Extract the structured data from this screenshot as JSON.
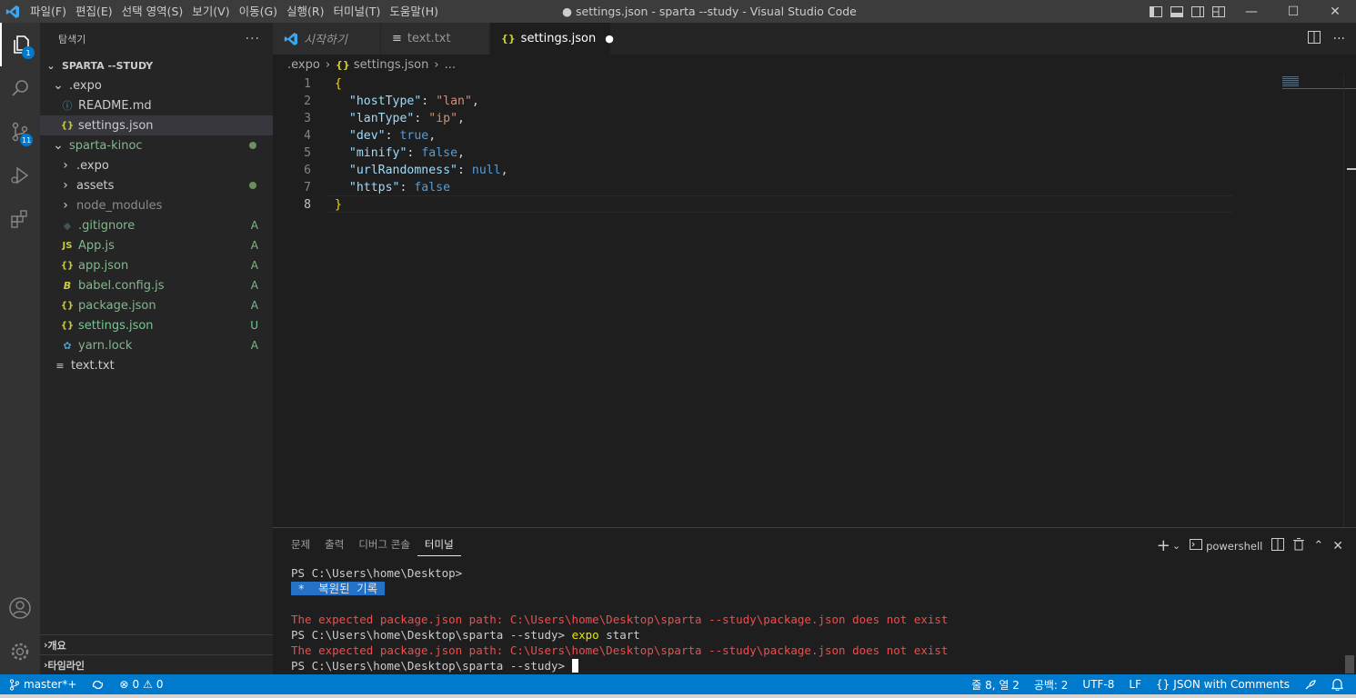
{
  "titlebar": {
    "menu": [
      "파일(F)",
      "편집(E)",
      "선택 영역(S)",
      "보기(V)",
      "이동(G)",
      "실행(R)",
      "터미널(T)",
      "도움말(H)"
    ],
    "title": "● settings.json - sparta --study - Visual Studio Code",
    "window_controls": {
      "minimize": "—",
      "maximize": "☐",
      "close": "✕"
    }
  },
  "activity": {
    "explorer_badge": "1",
    "scm_badge": "11"
  },
  "sidebar": {
    "title": "탐색기",
    "more": "···",
    "root": "SPARTA --STUDY",
    "tree": [
      {
        "label": ".expo",
        "icon": "chevron-down",
        "indent": 0,
        "status": ""
      },
      {
        "label": "README.md",
        "icon": "ⓘ",
        "indent": 1,
        "status": ""
      },
      {
        "label": "settings.json",
        "icon": "{}",
        "indent": 1,
        "status": ""
      },
      {
        "label": "sparta-kinoc",
        "icon": "chevron-down",
        "indent": 0,
        "status": "dot"
      },
      {
        "label": ".expo",
        "icon": "chevron-right",
        "indent": 1,
        "status": ""
      },
      {
        "label": "assets",
        "icon": "chevron-right",
        "indent": 1,
        "status": "dot"
      },
      {
        "label": "node_modules",
        "icon": "chevron-right",
        "indent": 1,
        "status": ""
      },
      {
        "label": ".gitignore",
        "icon": "◆",
        "indent": 1,
        "status": "A"
      },
      {
        "label": "App.js",
        "icon": "JS",
        "indent": 1,
        "status": "A"
      },
      {
        "label": "app.json",
        "icon": "{}",
        "indent": 1,
        "status": "A"
      },
      {
        "label": "babel.config.js",
        "icon": "B",
        "indent": 1,
        "status": "A"
      },
      {
        "label": "package.json",
        "icon": "{}",
        "indent": 1,
        "status": "A"
      },
      {
        "label": "settings.json",
        "icon": "{}",
        "indent": 1,
        "status": "U"
      },
      {
        "label": "yarn.lock",
        "icon": "yarn",
        "indent": 1,
        "status": "A"
      },
      {
        "label": "text.txt",
        "icon": "≡",
        "indent": 0,
        "status": ""
      }
    ],
    "outline": "개요",
    "timeline": "타임라인"
  },
  "tabs": [
    {
      "label": "시작하기",
      "icon": "vscode"
    },
    {
      "label": "text.txt",
      "icon": "≡"
    },
    {
      "label": "settings.json",
      "icon": "{}",
      "active": true,
      "dirty": "●"
    }
  ],
  "breadcrumb": {
    "parts": [
      ".expo",
      "{} settings.json",
      "..."
    ]
  },
  "editor": {
    "line_numbers": [
      "1",
      "2",
      "3",
      "4",
      "5",
      "6",
      "7",
      "8"
    ],
    "lines": [
      [
        [
          "br",
          "{"
        ]
      ],
      [
        [
          "p",
          "  "
        ],
        [
          "k",
          "\"hostType\""
        ],
        [
          "p",
          ": "
        ],
        [
          "s",
          "\"lan\""
        ],
        [
          "p",
          ","
        ]
      ],
      [
        [
          "p",
          "  "
        ],
        [
          "k",
          "\"lanType\""
        ],
        [
          "p",
          ": "
        ],
        [
          "s",
          "\"ip\""
        ],
        [
          "p",
          ","
        ]
      ],
      [
        [
          "p",
          "  "
        ],
        [
          "k",
          "\"dev\""
        ],
        [
          "p",
          ": "
        ],
        [
          "b",
          "true"
        ],
        [
          "p",
          ","
        ]
      ],
      [
        [
          "p",
          "  "
        ],
        [
          "k",
          "\"minify\""
        ],
        [
          "p",
          ": "
        ],
        [
          "b",
          "false"
        ],
        [
          "p",
          ","
        ]
      ],
      [
        [
          "p",
          "  "
        ],
        [
          "k",
          "\"urlRandomness\""
        ],
        [
          "p",
          ": "
        ],
        [
          "b",
          "null"
        ],
        [
          "p",
          ","
        ]
      ],
      [
        [
          "p",
          "  "
        ],
        [
          "k",
          "\"https\""
        ],
        [
          "p",
          ": "
        ],
        [
          "b",
          "false"
        ]
      ],
      [
        [
          "br",
          "}"
        ]
      ]
    ]
  },
  "panel": {
    "tabs": [
      "문제",
      "출력",
      "디버그 콘솔",
      "터미널"
    ],
    "active_tab": "터미널",
    "shell": "powershell",
    "terminal_lines": [
      {
        "t": "PS C:\\Users\\home\\Desktop>",
        "c": "n"
      },
      {
        "t": " *  복원된 기록 ",
        "c": "hl"
      },
      {
        "t": "",
        "c": "n"
      },
      {
        "t": "The expected package.json path: C:\\Users\\home\\Desktop\\sparta --study\\package.json does not exist",
        "c": "err"
      },
      {
        "t": "PS C:\\Users\\home\\Desktop\\sparta --study> ",
        "c": "n",
        "cmd": "expo",
        "rest": " start"
      },
      {
        "t": "The expected package.json path: C:\\Users\\home\\Desktop\\sparta --study\\package.json does not exist",
        "c": "err"
      },
      {
        "t": "PS C:\\Users\\home\\Desktop\\sparta --study> ",
        "c": "n",
        "cursor": true
      }
    ]
  },
  "statusbar": {
    "branch": "master*+",
    "errors": "0",
    "warnings": "0",
    "position": "줄 8, 열 2",
    "indent": "공백: 2",
    "encoding": "UTF-8",
    "eol": "LF",
    "language": "JSON with Comments"
  },
  "colors": {
    "accent": "#007acc",
    "git_added": "#81b88b",
    "git_untracked": "#73c991"
  }
}
